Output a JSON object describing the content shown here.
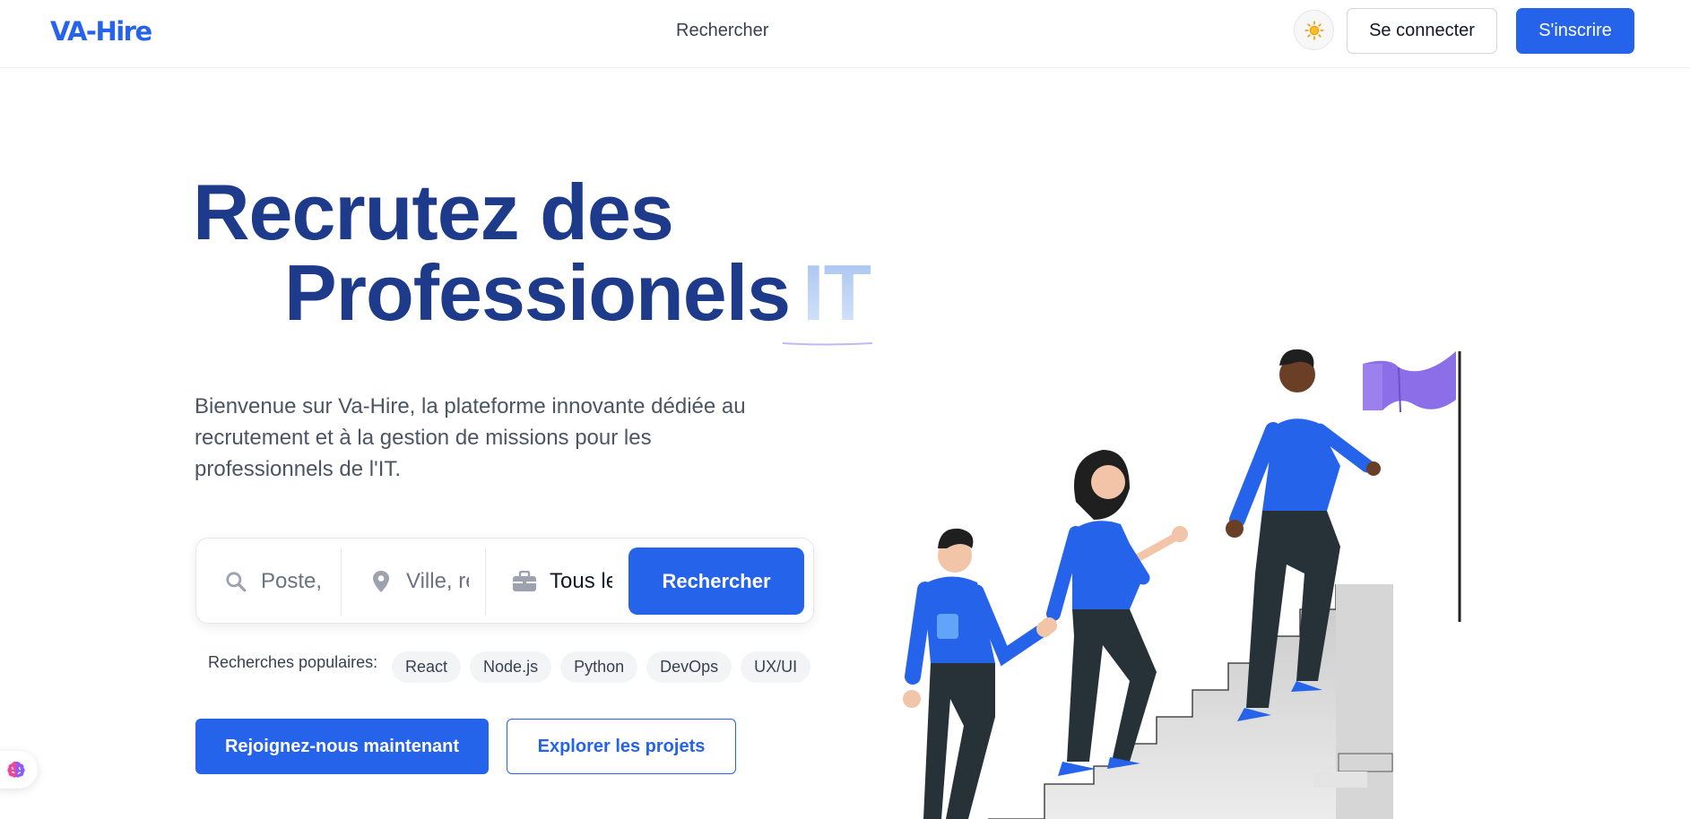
{
  "header": {
    "logo": "VA-Hire",
    "nav_search": "Rechercher",
    "theme_icon": "sun-icon",
    "login_label": "Se connecter",
    "signup_label": "S'inscrire"
  },
  "hero": {
    "title_line1": "Recrutez des",
    "title_line2": "Professionels",
    "title_highlight": "IT",
    "lead": "Bienvenue sur Va-Hire, la plateforme innovante dédiée au recrutement et à la gestion de missions pour les professionnels de l'IT."
  },
  "search": {
    "job_placeholder": "Poste, compétence...",
    "city_placeholder": "Ville, région...",
    "type_value": "Tous les types",
    "button_label": "Rechercher",
    "icons": [
      "search-icon",
      "location-pin-icon",
      "briefcase-icon"
    ]
  },
  "popular": {
    "label": "Recherches populaires:",
    "tags": [
      "React",
      "Node.js",
      "Python",
      "DevOps",
      "UX/UI"
    ]
  },
  "cta": {
    "primary": "Rejoignez-nous maintenant",
    "secondary": "Explorer les projets"
  },
  "colors": {
    "brand": "#2563eb",
    "title": "#1e3a8a",
    "flag": "#8b6ee8"
  }
}
